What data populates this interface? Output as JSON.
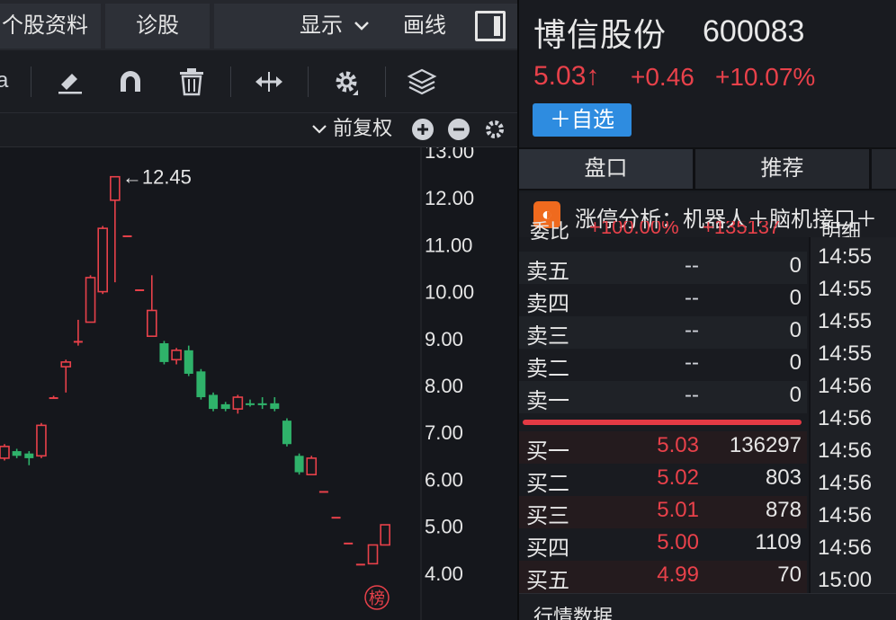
{
  "left": {
    "tabs": [
      "个股资料",
      "诊股"
    ],
    "display_label": "显示",
    "draw_label": "画线",
    "adjust_label": "前复权",
    "yaxis_labels": [
      "13.00",
      "12.00",
      "11.00",
      "10.00",
      "9.00",
      "8.00",
      "7.00",
      "6.00",
      "5.00",
      "4.00"
    ],
    "max_marker": "←12.45",
    "badge": "榜",
    "partial_toolbar_text": "a"
  },
  "chart_data": {
    "type": "candlestick",
    "ylim": [
      3.5,
      13.0
    ],
    "yticks": [
      13,
      12,
      11,
      10,
      9,
      8,
      7,
      6,
      5,
      4
    ],
    "max_annotation": {
      "value": 12.45,
      "label": "←12.45"
    },
    "candles": [
      {
        "open": 6.45,
        "close": 6.7,
        "high": 6.75,
        "low": 6.4
      },
      {
        "open": 6.6,
        "close": 6.5,
        "high": 6.65,
        "low": 6.45
      },
      {
        "open": 6.55,
        "close": 6.45,
        "high": 6.6,
        "low": 6.3
      },
      {
        "open": 6.5,
        "close": 7.15,
        "high": 7.2,
        "low": 6.45
      },
      {
        "open": 7.75,
        "close": 7.75,
        "high": 7.78,
        "low": 7.72
      },
      {
        "open": 8.4,
        "close": 8.5,
        "high": 8.55,
        "low": 7.85
      },
      {
        "open": 8.95,
        "close": 8.95,
        "high": 9.4,
        "low": 8.85
      },
      {
        "open": 9.35,
        "close": 10.3,
        "high": 10.35,
        "low": 9.35
      },
      {
        "open": 10.0,
        "close": 11.35,
        "high": 11.4,
        "low": 9.95
      },
      {
        "open": 11.95,
        "close": 12.45,
        "high": 12.45,
        "low": 10.2
      },
      {
        "open": 11.2,
        "close": 11.2,
        "high": 11.2,
        "low": 11.2
      },
      {
        "open": 10.05,
        "close": 10.05,
        "high": 10.05,
        "low": 10.05
      },
      {
        "open": 9.05,
        "close": 9.6,
        "high": 10.35,
        "low": 9.05
      },
      {
        "open": 8.9,
        "close": 8.5,
        "high": 8.95,
        "low": 8.45
      },
      {
        "open": 8.55,
        "close": 8.75,
        "high": 8.8,
        "low": 8.45
      },
      {
        "open": 8.75,
        "close": 8.25,
        "high": 8.85,
        "low": 8.2
      },
      {
        "open": 8.3,
        "close": 7.75,
        "high": 8.35,
        "low": 7.7
      },
      {
        "open": 7.8,
        "close": 7.5,
        "high": 7.85,
        "low": 7.45
      },
      {
        "open": 7.6,
        "close": 7.5,
        "high": 7.65,
        "low": 7.45
      },
      {
        "open": 7.5,
        "close": 7.75,
        "high": 7.8,
        "low": 7.4
      },
      {
        "open": 7.62,
        "close": 7.6,
        "high": 7.7,
        "low": 7.55
      },
      {
        "open": 7.62,
        "close": 7.58,
        "high": 7.75,
        "low": 7.5
      },
      {
        "open": 7.62,
        "close": 7.5,
        "high": 7.75,
        "low": 7.45
      },
      {
        "open": 7.25,
        "close": 6.75,
        "high": 7.3,
        "low": 6.7
      },
      {
        "open": 6.5,
        "close": 6.15,
        "high": 6.55,
        "low": 6.1
      },
      {
        "open": 6.1,
        "close": 6.45,
        "high": 6.5,
        "low": 6.1
      },
      {
        "open": 5.75,
        "close": 5.75,
        "high": 5.75,
        "low": 5.75
      },
      {
        "open": 5.2,
        "close": 5.2,
        "high": 5.2,
        "low": 5.2
      },
      {
        "open": 4.65,
        "close": 4.65,
        "high": 4.65,
        "low": 4.65
      },
      {
        "open": 4.2,
        "close": 4.2,
        "high": 4.2,
        "low": 4.2
      },
      {
        "open": 4.2,
        "close": 4.6,
        "high": 4.6,
        "low": 4.2
      },
      {
        "open": 4.6,
        "close": 5.03,
        "high": 5.03,
        "low": 4.6
      }
    ]
  },
  "right": {
    "name": "博信股份",
    "code": "600083",
    "price": "5.03↑",
    "change": "+0.46",
    "pct": "+10.07%",
    "watch_label": "＋自选",
    "tabs": [
      "盘口",
      "推荐"
    ],
    "limit_text": "涨停分析：机器人＋脑机接口＋",
    "limit_icon": "◐",
    "peek_left": "委比",
    "peek_mid": "+100.00%",
    "peek_right": "+135137",
    "peek_ticks": "明细",
    "sells": [
      {
        "label": "卖五",
        "price": "--",
        "vol": "0"
      },
      {
        "label": "卖四",
        "price": "--",
        "vol": "0"
      },
      {
        "label": "卖三",
        "price": "--",
        "vol": "0"
      },
      {
        "label": "卖二",
        "price": "--",
        "vol": "0"
      },
      {
        "label": "卖一",
        "price": "--",
        "vol": "0"
      }
    ],
    "buys": [
      {
        "label": "买一",
        "price": "5.03",
        "vol": "136297"
      },
      {
        "label": "买二",
        "price": "5.02",
        "vol": "803"
      },
      {
        "label": "买三",
        "price": "5.01",
        "vol": "878"
      },
      {
        "label": "买四",
        "price": "5.00",
        "vol": "1109"
      },
      {
        "label": "买五",
        "price": "4.99",
        "vol": "70"
      }
    ],
    "ticks": [
      "14:55",
      "14:55",
      "14:55",
      "14:55",
      "14:56",
      "14:56",
      "14:56",
      "14:56",
      "14:56",
      "14:56",
      "15:00"
    ],
    "bottom_label": "行情数据",
    "colors": {
      "up": "#e8414a",
      "down": "#2fb26a",
      "accent": "#2e8ce0"
    }
  }
}
